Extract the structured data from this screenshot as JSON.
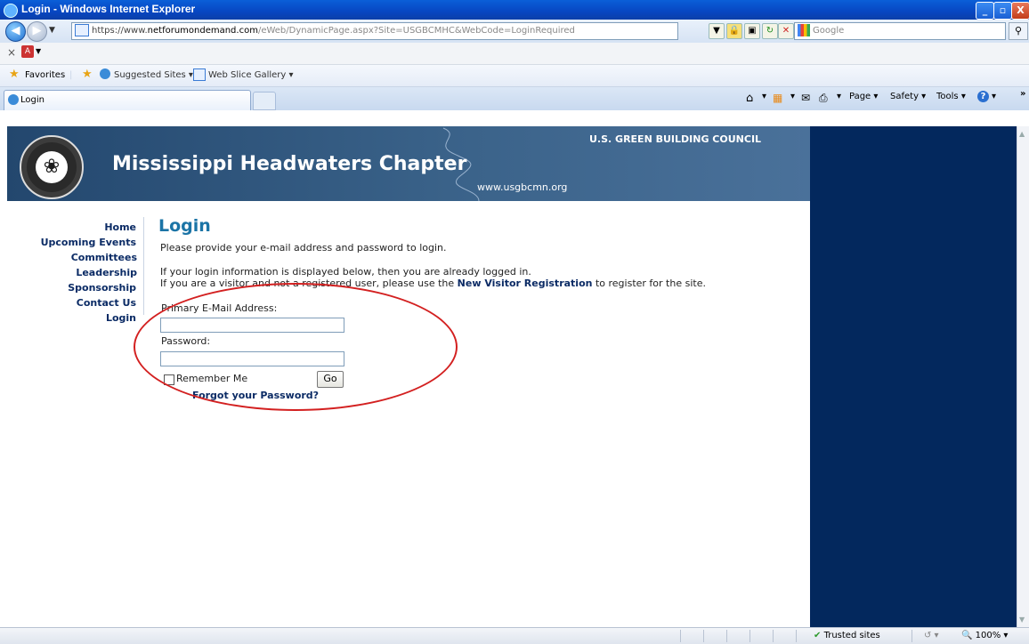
{
  "window": {
    "title": "Login - Windows Internet Explorer",
    "minimize": "_",
    "maximize": "▫",
    "close": "X"
  },
  "address": {
    "url_prefix": "https://www.",
    "url_domain": "netforumondemand.com",
    "url_path": "/eWeb/DynamicPage.aspx?Site=USGBCMHC&WebCode=LoginRequired",
    "search_placeholder": "Google"
  },
  "favorites": {
    "favorites_label": "Favorites",
    "suggested_sites": "Suggested Sites ▾",
    "web_slice_gallery": "Web Slice Gallery ▾"
  },
  "tab": {
    "active_label": "Login"
  },
  "commandbar": {
    "page": "Page ▾",
    "safety": "Safety ▾",
    "tools": "Tools ▾",
    "help": "?"
  },
  "site": {
    "chapter_title": "Mississippi Headwaters Chapter",
    "council": "U.S. GREEN BUILDING COUNCIL",
    "url": "www.usgbcmn.org"
  },
  "nav": [
    {
      "label": "Home"
    },
    {
      "label": "Upcoming Events"
    },
    {
      "label": "Committees Leadership"
    },
    {
      "label": "Sponsorship"
    },
    {
      "label": "Contact Us"
    },
    {
      "label": "Login"
    }
  ],
  "login": {
    "heading": "Login",
    "intro": "Please provide your e-mail address and password to login.",
    "info_line1": "If your login information is displayed below, then you are already logged in.",
    "info_line2_a": "If you are a visitor and not a registered user, please use the ",
    "info_line2_link": "New Visitor Registration",
    "info_line2_b": " to register for the site.",
    "email_label": "Primary E-Mail Address:",
    "email_value": "",
    "password_label": "Password:",
    "password_value": "",
    "remember_label": "Remember Me",
    "remember_checked": false,
    "go_label": "Go",
    "forgot_label": "Forgot your Password?"
  },
  "status": {
    "zone": "Trusted sites",
    "zoom": "100%"
  }
}
